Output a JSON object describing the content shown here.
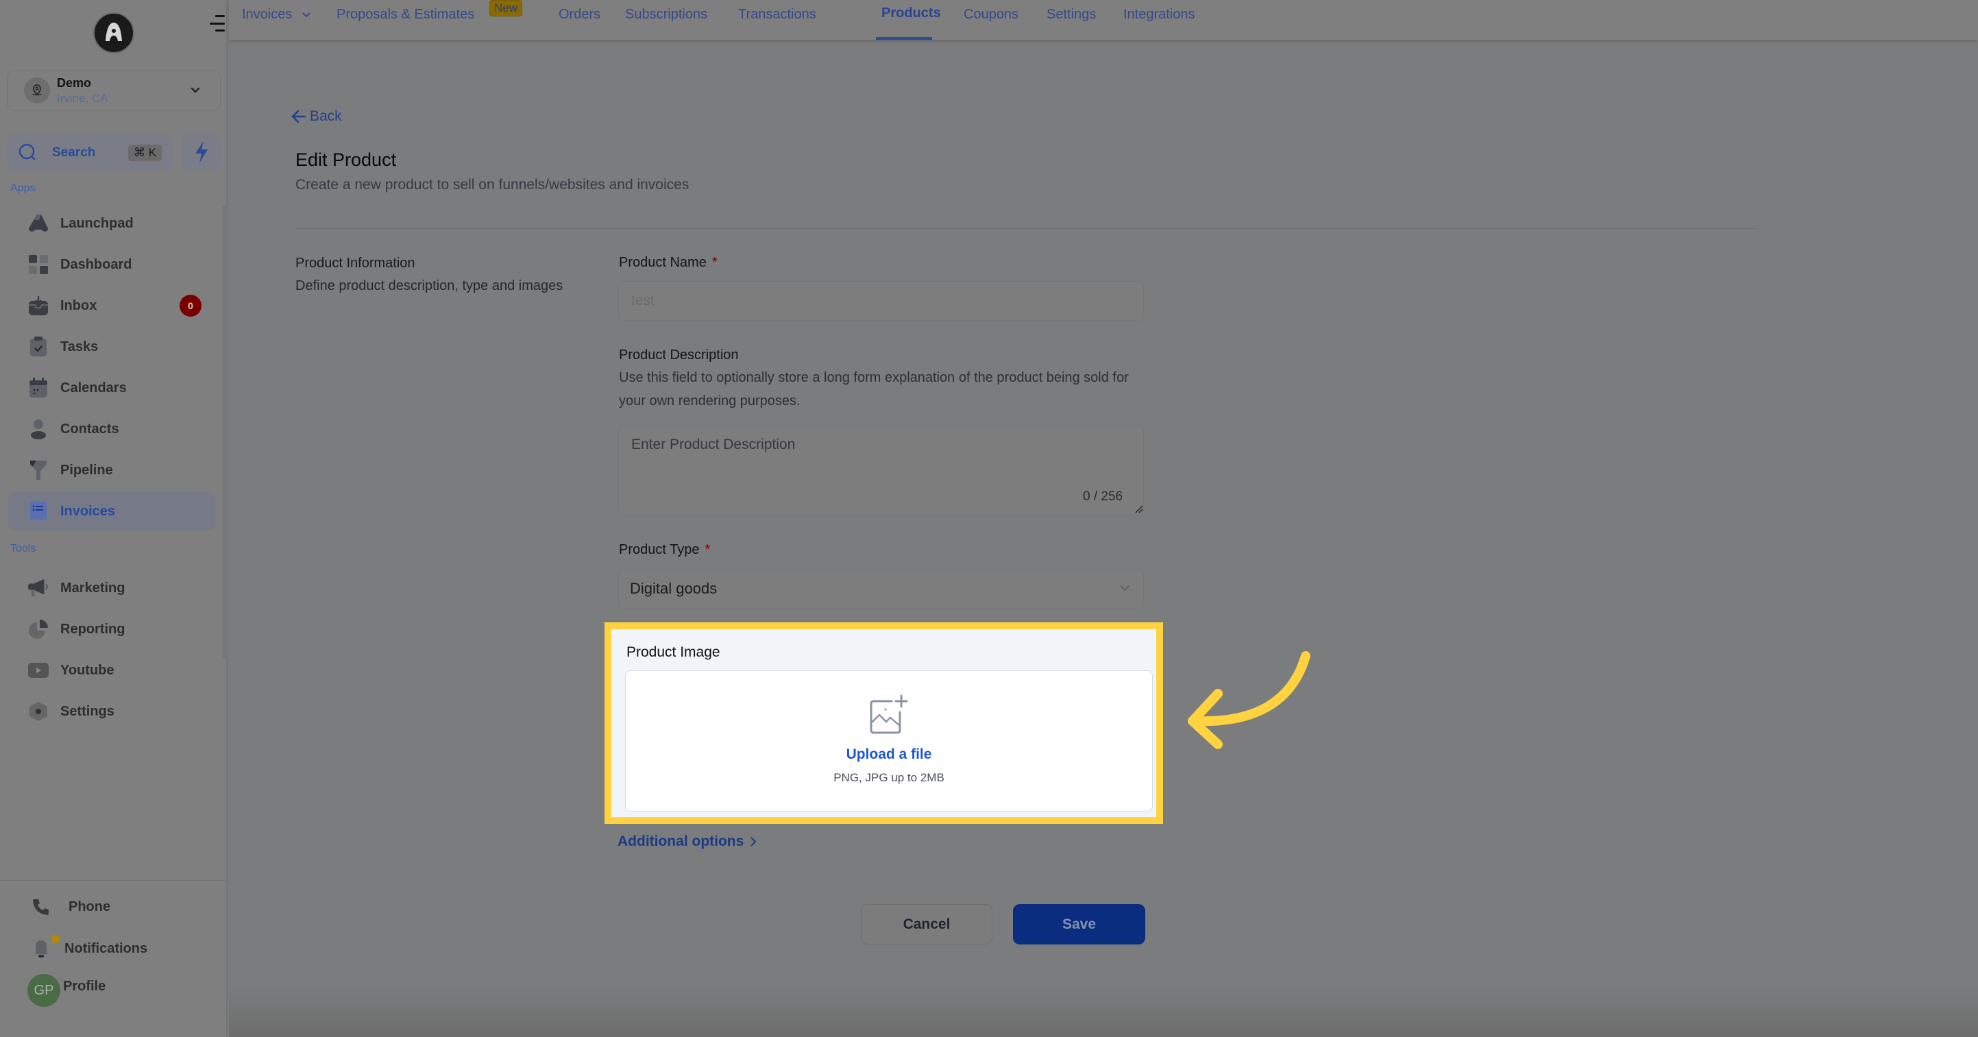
{
  "sidebar": {
    "logo_letter": "A",
    "location": {
      "name": "Demo",
      "city": "Irvine, CA"
    },
    "search": {
      "label": "Search",
      "shortcut": "⌘ K"
    },
    "apps_label": "Apps",
    "apps": [
      {
        "label": "Launchpad",
        "icon": "rocket-icon"
      },
      {
        "label": "Dashboard",
        "icon": "grid-icon"
      },
      {
        "label": "Inbox",
        "icon": "inbox-icon",
        "badge": "0"
      },
      {
        "label": "Tasks",
        "icon": "clipboard-check-icon"
      },
      {
        "label": "Calendars",
        "icon": "calendar-icon"
      },
      {
        "label": "Contacts",
        "icon": "user-icon"
      },
      {
        "label": "Pipeline",
        "icon": "funnel-icon"
      },
      {
        "label": "Invoices",
        "icon": "receipt-icon",
        "active": true
      }
    ],
    "tools_label": "Tools",
    "tools": [
      {
        "label": "Marketing",
        "icon": "megaphone-icon"
      },
      {
        "label": "Reporting",
        "icon": "pie-chart-icon"
      },
      {
        "label": "Youtube",
        "icon": "youtube-icon"
      },
      {
        "label": "Settings",
        "icon": "gear-icon"
      }
    ],
    "bottom": {
      "phone": "Phone",
      "notifications": "Notifications",
      "profile": "Profile",
      "avatar_initials": "GP"
    }
  },
  "topnav": {
    "tabs": [
      {
        "label": "Invoices",
        "dropdown": true
      },
      {
        "label": "Proposals & Estimates",
        "badge": "New"
      },
      {
        "label": "Orders"
      },
      {
        "label": "Subscriptions"
      },
      {
        "label": "Transactions"
      },
      {
        "label": "Products",
        "active": true
      },
      {
        "label": "Coupons"
      },
      {
        "label": "Settings"
      },
      {
        "label": "Integrations"
      }
    ]
  },
  "page": {
    "back_label": "Back",
    "title": "Edit Product",
    "subtitle": "Create a new product to sell on funnels/websites and invoices",
    "section": {
      "title": "Product Information",
      "description": "Define product description, type and images"
    },
    "form": {
      "product_name": {
        "label": "Product Name",
        "required": "*",
        "placeholder": "test",
        "value": ""
      },
      "product_description": {
        "label": "Product Description",
        "help": "Use this field to optionally store a long form explanation of the product being sold for your own rendering purposes.",
        "placeholder": "Enter Product Description",
        "counter": "0 / 256"
      },
      "product_type": {
        "label": "Product Type",
        "required": "*",
        "value": "Digital goods"
      },
      "product_image": {
        "label": "Product Image",
        "upload_label": "Upload a file",
        "hint": "PNG, JPG up to 2MB"
      },
      "additional_options": "Additional options"
    },
    "actions": {
      "cancel": "Cancel",
      "save": "Save"
    }
  },
  "annotation": {
    "highlight_color": "#ffd23f",
    "target": "Product Image"
  },
  "colors": {
    "accent": "#1e57d6",
    "save_button": "#0a2d80",
    "badge_red": "#7a0000"
  }
}
